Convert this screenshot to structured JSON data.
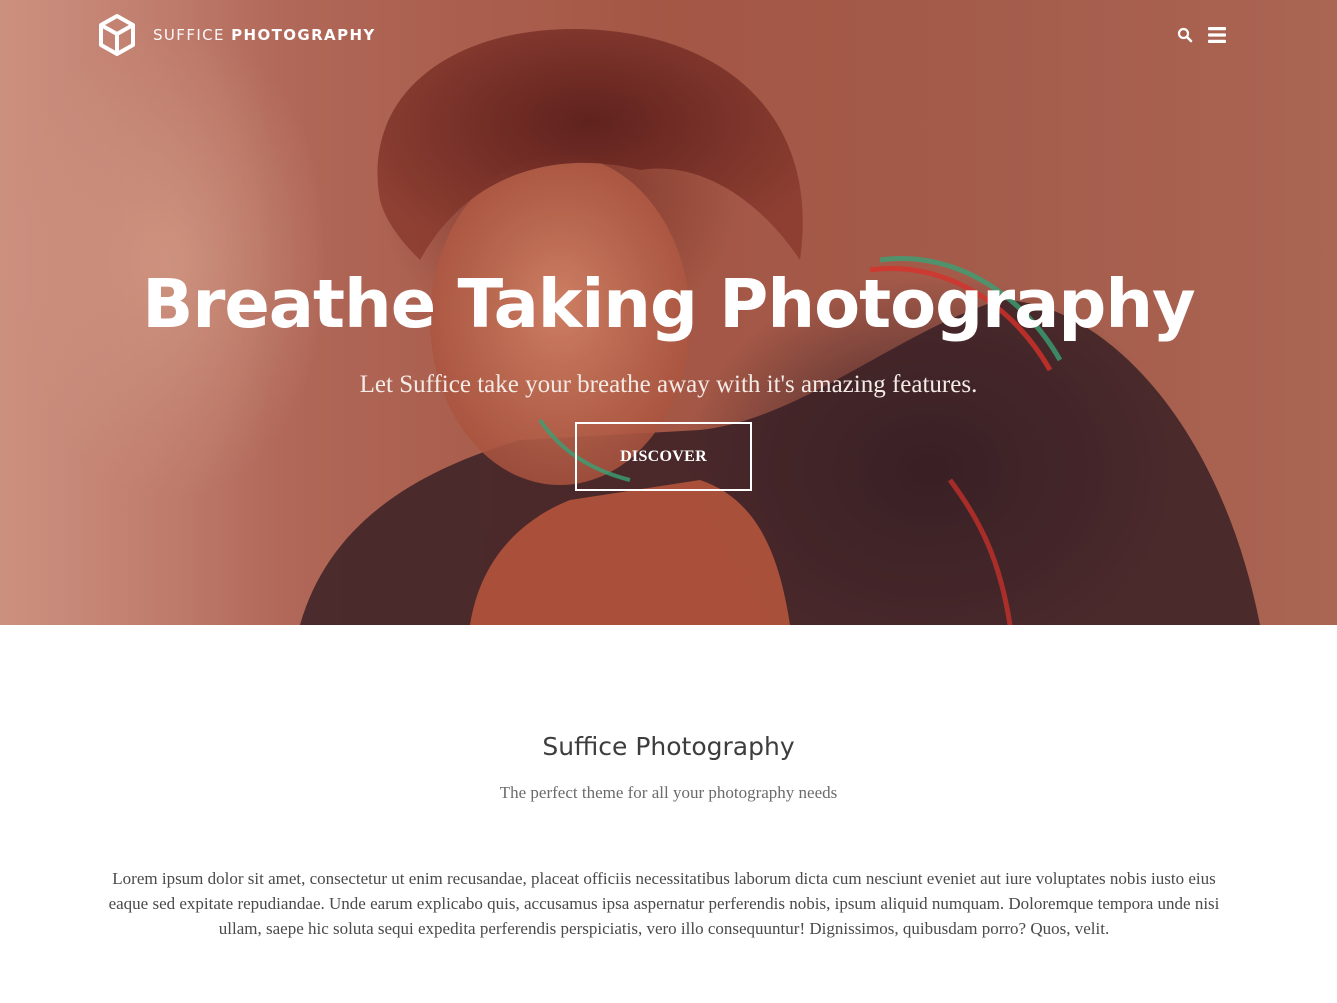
{
  "header": {
    "site_title_light": "SUFFICE",
    "site_title_bold": "PHOTOGRAPHY",
    "logo_icon": "cube-logo-icon",
    "search_icon": "search-icon",
    "menu_icon": "hamburger-menu-icon"
  },
  "hero": {
    "title": "Breathe Taking Photography",
    "subtitle": "Let Suffice take your breathe away with it's amazing features.",
    "button_label": "DISCOVER"
  },
  "intro": {
    "title": "Suffice Photography",
    "tagline": "The perfect theme for all your photography needs",
    "body": "Lorem ipsum dolor sit amet, consectetur ut enim recusandae, placeat officiis necessitatibus laborum dicta cum nesciunt eveniet aut iure voluptates nobis iusto eius eaque sed expitate repudiandae. Unde earum explicabo quis, accusamus ipsa aspernatur perferendis nobis, ipsum aliquid numquam. Doloremque tempora unde nisi ullam, saepe hic soluta sequi expedita perferendis perspiciatis, vero illo consequuntur! Dignissimos, quibusdam porro? Quos, velit."
  },
  "colors": {
    "hero_tint": "#b06a58",
    "text_white": "#ffffff",
    "heading_dark": "#3d3d3d",
    "body_text": "#4a4a4a"
  }
}
